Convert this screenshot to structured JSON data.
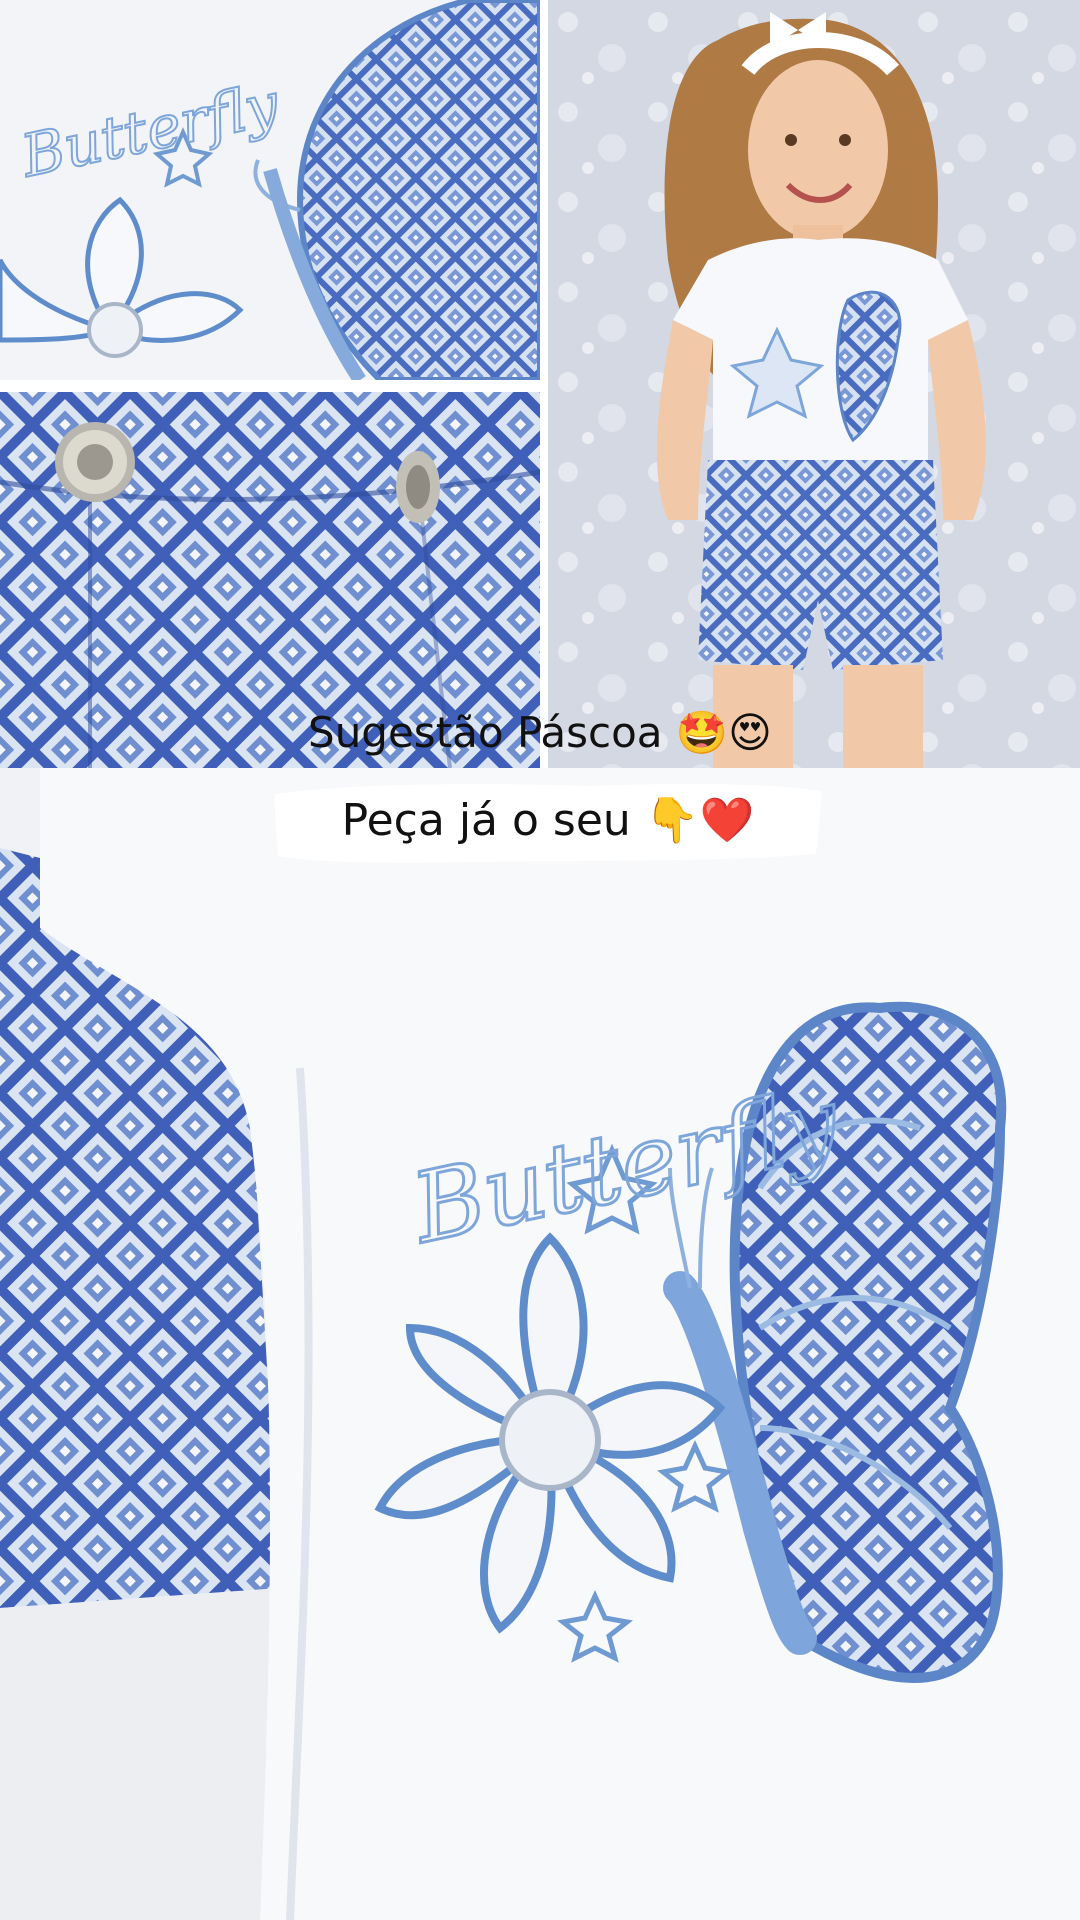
{
  "caption": {
    "line1": "Sugestão Páscoa 🤩😍",
    "line2": "Peça já o seu 👇❤️"
  },
  "embroidery": {
    "word": "Butterfly"
  },
  "colors": {
    "fabric_white": "#f4f6fa",
    "pattern_blue": "#3f5fb8",
    "pattern_light": "#b9cbe8",
    "thread_blue": "#6a9ad3",
    "backdrop": "#d9dde6"
  },
  "icons": [
    "star-struck-emoji",
    "heart-eyes-emoji",
    "pointing-down-emoji",
    "red-heart-emoji"
  ]
}
